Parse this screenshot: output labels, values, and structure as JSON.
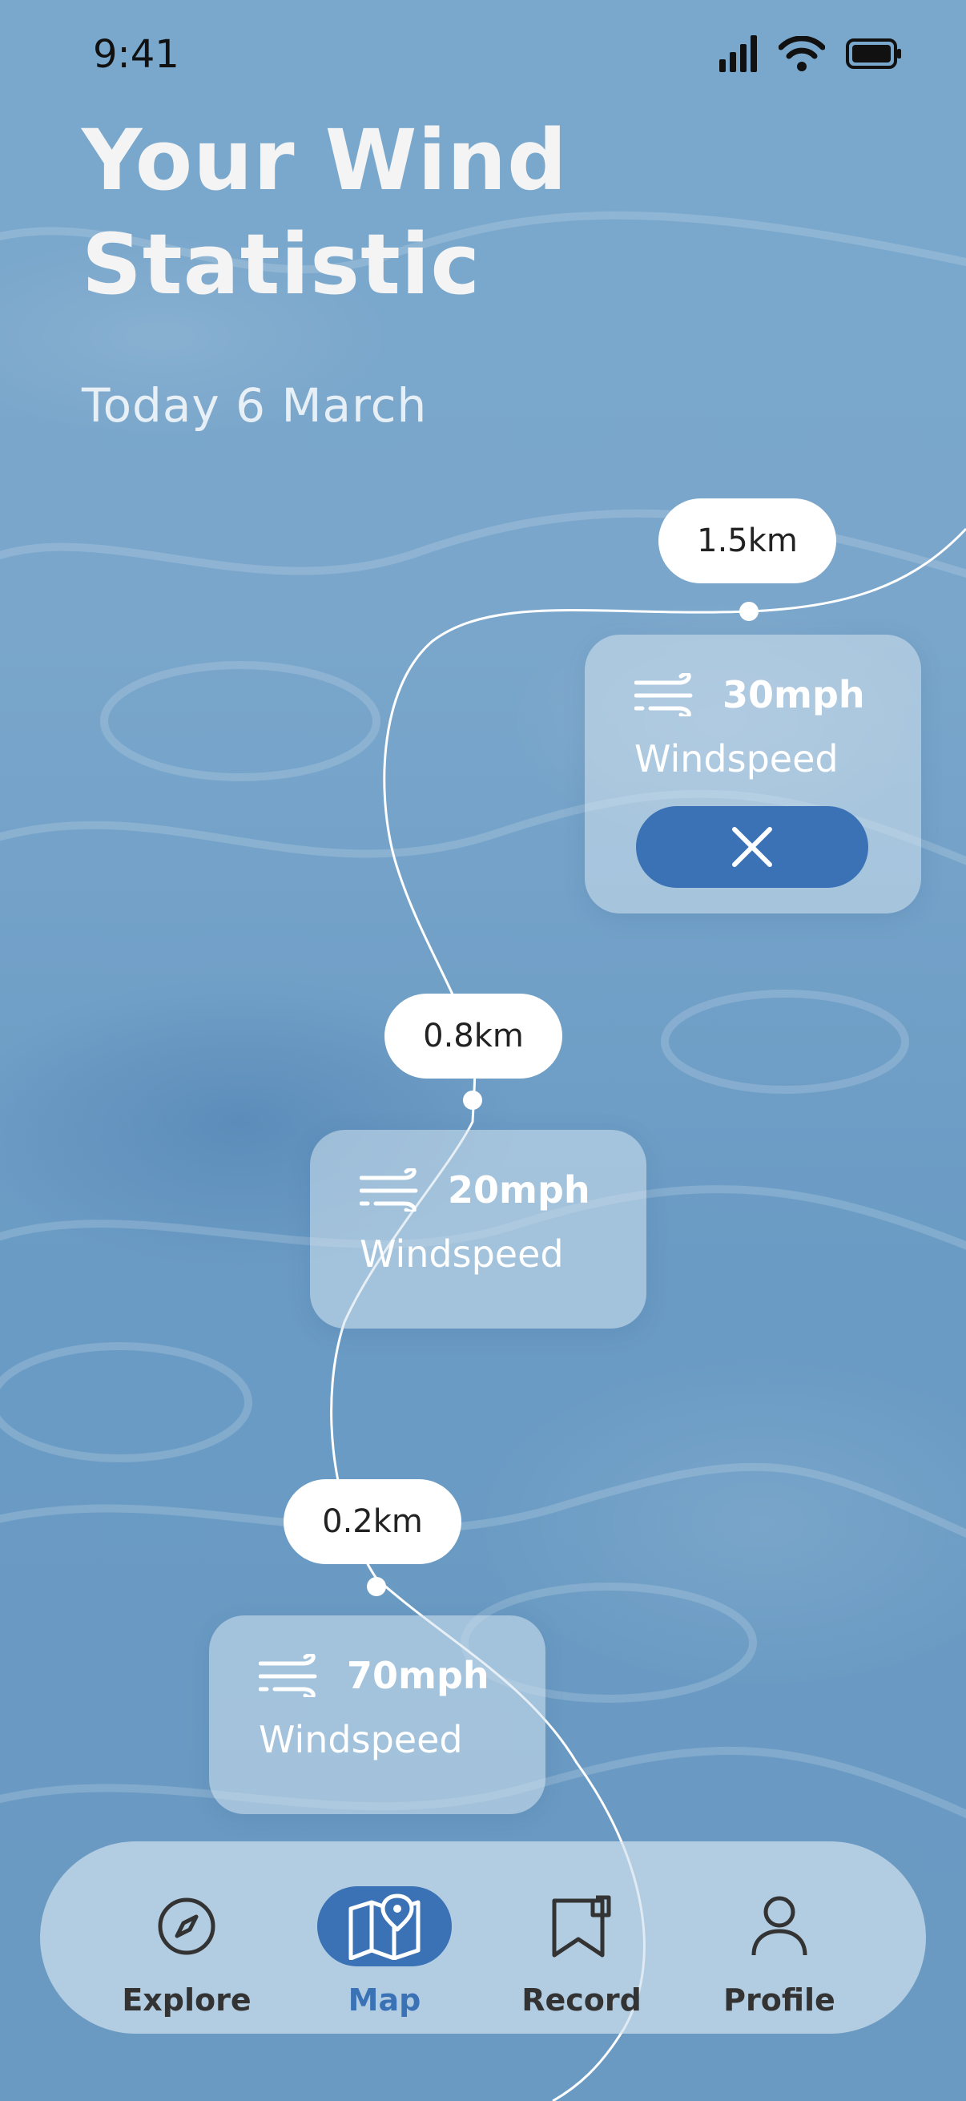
{
  "status_bar": {
    "time": "9:41"
  },
  "header": {
    "title_line1": "Your Wind",
    "title_line2": "Statistic",
    "date": "Today 6 March"
  },
  "stats": [
    {
      "distance": "1.5km",
      "speed": "30mph",
      "label": "Windspeed",
      "expanded": true
    },
    {
      "distance": "0.8km",
      "speed": "20mph",
      "label": "Windspeed",
      "expanded": false
    },
    {
      "distance": "0.2km",
      "speed": "70mph",
      "label": "Windspeed",
      "expanded": false
    }
  ],
  "tabs": [
    {
      "label": "Explore",
      "icon": "compass-icon",
      "active": false
    },
    {
      "label": "Map",
      "icon": "map-icon",
      "active": true
    },
    {
      "label": "Record",
      "icon": "bookmark-icon",
      "active": false
    },
    {
      "label": "Profile",
      "icon": "user-icon",
      "active": false
    }
  ],
  "colors": {
    "accent": "#3a72b5",
    "background": "#7aa6cb",
    "card": "#d2e1ee"
  }
}
